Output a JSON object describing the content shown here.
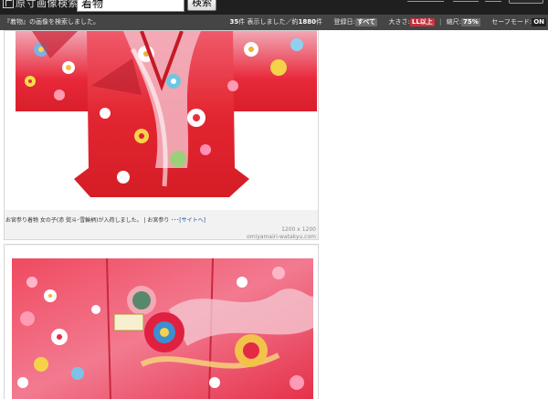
{
  "header": {
    "logo_text": "原寸画像検索",
    "search_value": "着物",
    "search_button": "検索"
  },
  "status": {
    "query_message": "『着物』の画像を検索しました。",
    "shown_count": "35",
    "shown_suffix": "件 表示しました／約",
    "total_count": "1880",
    "total_suffix": "件",
    "date_label": "登録日:",
    "date_value": "すべて",
    "size_label": "大きさ:",
    "size_value": "LL以上",
    "divider": "|",
    "zoom_label": "縮尺:",
    "zoom_value": "75%",
    "safe_label": "セーフモード:",
    "safe_value": "ON"
  },
  "results": [
    {
      "caption_text": "お宮参り着物 女の子(赤 熨斗･雪輪柄)が入荷しました。 | お宮参り ･･･",
      "site_link": "[サイトへ]",
      "dimensions": "1200 x 1200",
      "domain": "omiyamairi-watakyu.com"
    },
    {
      "caption_text": "",
      "site_link": "",
      "dimensions": "",
      "domain": ""
    }
  ],
  "colors": {
    "topbar": "#1f1f1f",
    "statusbar": "#454545",
    "kimono_red": "#e0202a",
    "link_blue": "#1a4fa8",
    "size_chip": "#c8323c"
  }
}
